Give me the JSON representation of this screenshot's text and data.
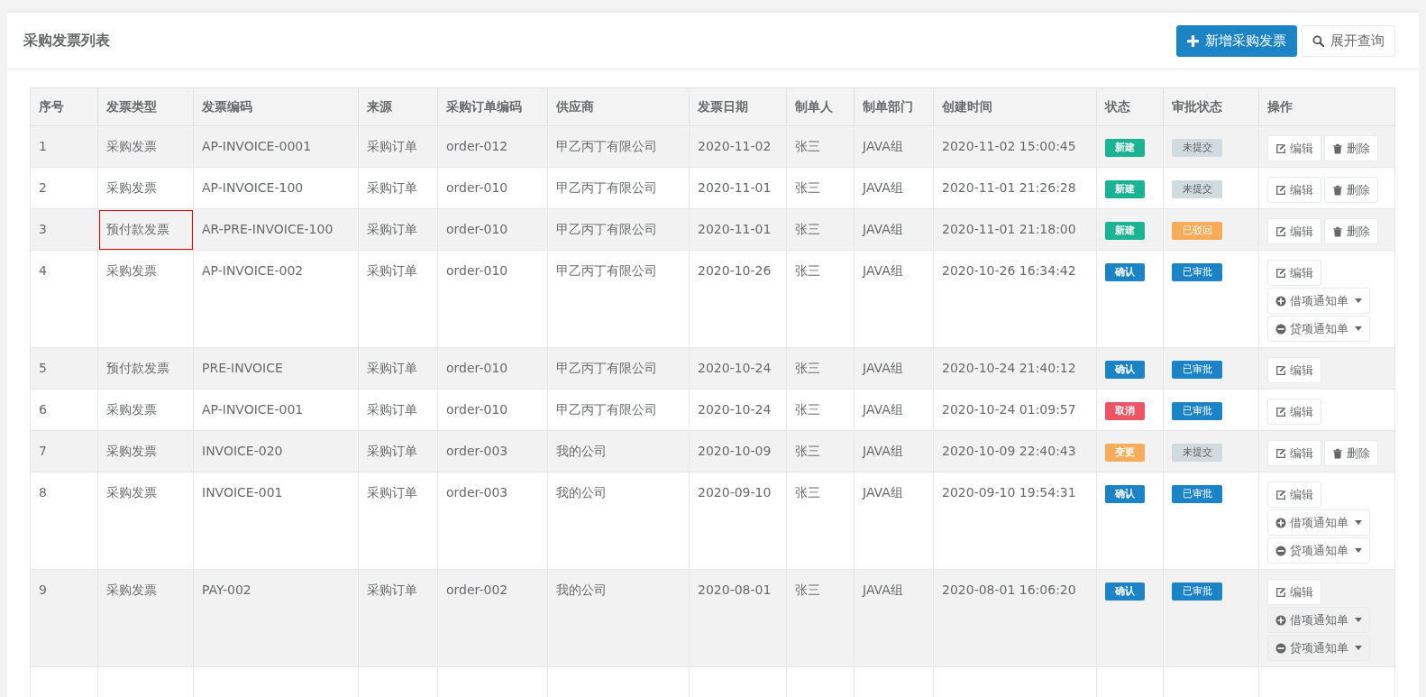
{
  "panel": {
    "title": "采购发票列表",
    "buttons": [
      {
        "kind": "add",
        "label": "新增采购发票"
      },
      {
        "kind": "search",
        "label": "展开查询"
      }
    ]
  },
  "table": {
    "columns": [
      "序号",
      "发票类型",
      "发票编码",
      "来源",
      "采购订单编码",
      "供应商",
      "发票日期",
      "制单人",
      "制单部门",
      "创建时间",
      "状态",
      "审批状态",
      "操作"
    ],
    "rows": [
      {
        "cells": [
          "1",
          "采购发票",
          "AP-INVOICE-0001",
          "采购订单",
          "order-012",
          "甲乙丙丁有限公司",
          "2020-11-02",
          "张三",
          "JAVA组",
          "2020-11-02 15:00:45"
        ],
        "type_outlined": false,
        "status": {
          "label": "新建",
          "color": "#1ab394"
        },
        "approval": {
          "label": "未提交",
          "color": "#d1dade"
        },
        "actions": [
          {
            "kind": "edit",
            "label": "编辑",
            "disabled": false
          },
          {
            "kind": "delete",
            "label": "删除",
            "disabled": false
          }
        ]
      },
      {
        "cells": [
          "2",
          "采购发票",
          "AP-INVOICE-100",
          "采购订单",
          "order-010",
          "甲乙丙丁有限公司",
          "2020-11-01",
          "张三",
          "JAVA组",
          "2020-11-01 21:26:28"
        ],
        "type_outlined": false,
        "status": {
          "label": "新建",
          "color": "#1ab394"
        },
        "approval": {
          "label": "未提交",
          "color": "#d1dade"
        },
        "actions": [
          {
            "kind": "edit",
            "label": "编辑",
            "disabled": false
          },
          {
            "kind": "delete",
            "label": "删除",
            "disabled": false
          }
        ]
      },
      {
        "cells": [
          "3",
          "预付款发票",
          "AR-PRE-INVOICE-100",
          "采购订单",
          "order-010",
          "甲乙丙丁有限公司",
          "2020-11-01",
          "张三",
          "JAVA组",
          "2020-11-01 21:18:00"
        ],
        "type_outlined": true,
        "status": {
          "label": "新建",
          "color": "#1ab394"
        },
        "approval": {
          "label": "已驳回",
          "color": "#f8ac59"
        },
        "actions": [
          {
            "kind": "edit",
            "label": "编辑",
            "disabled": false
          },
          {
            "kind": "delete",
            "label": "删除",
            "disabled": false
          }
        ]
      },
      {
        "cells": [
          "4",
          "采购发票",
          "AP-INVOICE-002",
          "采购订单",
          "order-010",
          "甲乙丙丁有限公司",
          "2020-10-26",
          "张三",
          "JAVA组",
          "2020-10-26 16:34:42"
        ],
        "type_outlined": false,
        "status": {
          "label": "确认",
          "color": "#1c84c6"
        },
        "approval": {
          "label": "已审批",
          "color": "#1c84c6"
        },
        "actions": [
          {
            "kind": "edit",
            "label": "编辑",
            "disabled": false
          },
          {
            "kind": "debit",
            "label": "借项通知单",
            "disabled": false
          },
          {
            "kind": "credit",
            "label": "贷项通知单",
            "disabled": false
          }
        ]
      },
      {
        "cells": [
          "5",
          "预付款发票",
          "PRE-INVOICE",
          "采购订单",
          "order-010",
          "甲乙丙丁有限公司",
          "2020-10-24",
          "张三",
          "JAVA组",
          "2020-10-24 21:40:12"
        ],
        "type_outlined": false,
        "status": {
          "label": "确认",
          "color": "#1c84c6"
        },
        "approval": {
          "label": "已审批",
          "color": "#1c84c6"
        },
        "actions": [
          {
            "kind": "edit",
            "label": "编辑",
            "disabled": false
          }
        ]
      },
      {
        "cells": [
          "6",
          "采购发票",
          "AP-INVOICE-001",
          "采购订单",
          "order-010",
          "甲乙丙丁有限公司",
          "2020-10-24",
          "张三",
          "JAVA组",
          "2020-10-24 01:09:57"
        ],
        "type_outlined": false,
        "status": {
          "label": "取消",
          "color": "#ed5565"
        },
        "approval": {
          "label": "已审批",
          "color": "#1c84c6"
        },
        "actions": [
          {
            "kind": "edit",
            "label": "编辑",
            "disabled": false
          }
        ]
      },
      {
        "cells": [
          "7",
          "采购发票",
          "INVOICE-020",
          "采购订单",
          "order-003",
          "我的公司",
          "2020-10-09",
          "张三",
          "JAVA组",
          "2020-10-09 22:40:43"
        ],
        "type_outlined": false,
        "status": {
          "label": "变更",
          "color": "#f8ac59"
        },
        "approval": {
          "label": "未提交",
          "color": "#d1dade"
        },
        "actions": [
          {
            "kind": "edit",
            "label": "编辑",
            "disabled": false
          },
          {
            "kind": "delete",
            "label": "删除",
            "disabled": false
          }
        ]
      },
      {
        "cells": [
          "8",
          "采购发票",
          "INVOICE-001",
          "采购订单",
          "order-003",
          "我的公司",
          "2020-09-10",
          "张三",
          "JAVA组",
          "2020-09-10 19:54:31"
        ],
        "type_outlined": false,
        "status": {
          "label": "确认",
          "color": "#1c84c6"
        },
        "approval": {
          "label": "已审批",
          "color": "#1c84c6"
        },
        "actions": [
          {
            "kind": "edit",
            "label": "编辑",
            "disabled": false
          },
          {
            "kind": "debit",
            "label": "借项通知单",
            "disabled": false
          },
          {
            "kind": "credit",
            "label": "贷项通知单",
            "disabled": false
          }
        ]
      },
      {
        "cells": [
          "9",
          "采购发票",
          "PAY-002",
          "采购订单",
          "order-002",
          "我的公司",
          "2020-08-01",
          "张三",
          "JAVA组",
          "2020-08-01 16:06:20"
        ],
        "type_outlined": false,
        "status": {
          "label": "确认",
          "color": "#1c84c6"
        },
        "approval": {
          "label": "已审批",
          "color": "#1c84c6"
        },
        "actions": [
          {
            "kind": "edit",
            "label": "编辑",
            "disabled": false
          },
          {
            "kind": "debit",
            "label": "借项通知单",
            "disabled": true
          },
          {
            "kind": "credit",
            "label": "贷项通知单",
            "disabled": true
          }
        ]
      }
    ]
  }
}
